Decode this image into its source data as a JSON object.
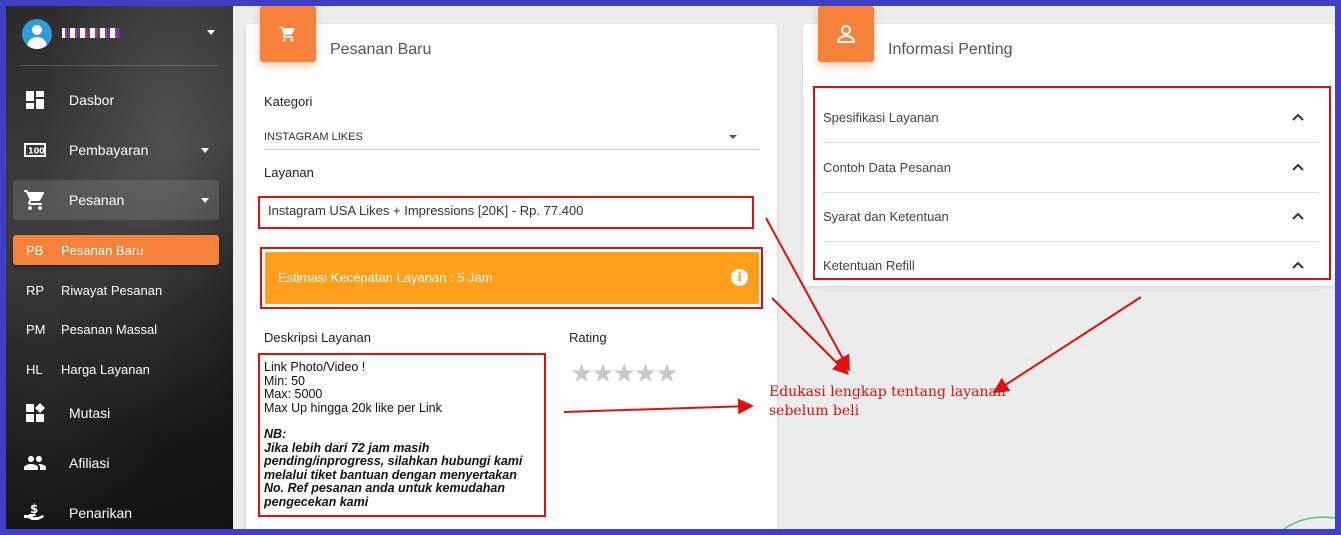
{
  "sidebar": {
    "username": "",
    "nav": [
      {
        "icon": "dashboard-icon",
        "label": "Dasbor"
      },
      {
        "icon": "payment-icon",
        "label": "Pembayaran"
      },
      {
        "icon": "cart-icon",
        "label": "Pesanan"
      }
    ],
    "sub": [
      {
        "abbr": "PB",
        "label": "Pesanan Baru"
      },
      {
        "abbr": "RP",
        "label": "Riwayat Pesanan"
      },
      {
        "abbr": "PM",
        "label": "Pesanan Massal"
      },
      {
        "abbr": "HL",
        "label": "Harga Layanan"
      }
    ],
    "nav2": [
      {
        "icon": "mutation-icon",
        "label": "Mutasi"
      },
      {
        "icon": "affiliate-icon",
        "label": "Afiliasi"
      },
      {
        "icon": "withdraw-icon",
        "label": "Penarikan"
      }
    ]
  },
  "order_card": {
    "title": "Pesanan Baru",
    "category_label": "Kategori",
    "category_value": "INSTAGRAM LIKES",
    "service_label": "Layanan",
    "service_value": "Instagram USA Likes + Impressions [20K]  -  Rp. 77.400",
    "speed_text": "Estimasi Kecepatan Layanan : 5 Jam",
    "desc_label": "Deskripsi Layanan",
    "rating_label": "Rating",
    "desc_lines": [
      "Link Photo/Video !",
      "Min: 50",
      "Max: 5000",
      "Max Up hingga 20k like per Link"
    ],
    "nb_lines": [
      "NB:",
      "Jika lebih dari 72 jam masih",
      "pending/inprogress, silahkan hubungi kami",
      "melalui tiket bantuan dengan menyertakan",
      "No. Ref pesanan anda untuk kemudahan",
      "pengecekan kami"
    ],
    "rating_stars": "★★★★★"
  },
  "info_card": {
    "title": "Informasi Penting",
    "items": [
      "Spesifikasi Layanan",
      "Contoh Data Pesanan",
      "Syarat dan Ketentuan",
      "Ketentuan Refill"
    ]
  },
  "annotation": {
    "line1": "Edukasi lengkap tentang layanan",
    "line2": "sebelum beli"
  },
  "colors": {
    "accent": "#f5813a",
    "speed_bar": "#ff9f1a",
    "annotation": "#e01010",
    "border": "#3d3fc4"
  }
}
